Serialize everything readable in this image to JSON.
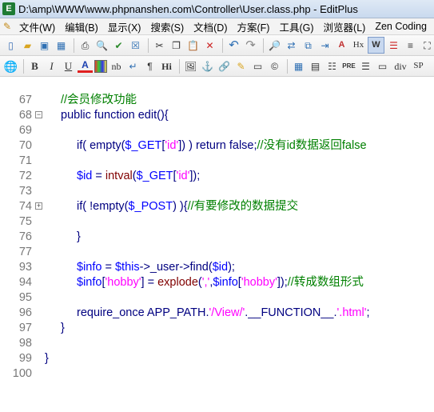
{
  "window": {
    "title": "D:\\amp\\WWW\\www.phpnanshen.com\\Controller\\User.class.php - EditPlus"
  },
  "menu": {
    "items": [
      "文件(W)",
      "编辑(B)",
      "显示(X)",
      "搜索(S)",
      "文档(D)",
      "方案(F)",
      "工具(G)",
      "浏览器(L)",
      "Zen Coding"
    ]
  },
  "toolbar2_text": {
    "nb": "nb",
    "para": "¶",
    "hi": "Hi",
    "pre": "PRE",
    "div": "div",
    "sp": "SP",
    "hx": "Hx"
  },
  "editor": {
    "lines": [
      {
        "num": "67",
        "fold": "",
        "code": ""
      },
      {
        "num": "68",
        "fold": "",
        "code": "comment1"
      },
      {
        "num": "69",
        "fold": "⊟",
        "code": "fn"
      },
      {
        "num": "70",
        "fold": "",
        "code": ""
      },
      {
        "num": "71",
        "fold": "",
        "code": "if1"
      },
      {
        "num": "72",
        "fold": "",
        "code": ""
      },
      {
        "num": "73",
        "fold": "",
        "code": "id"
      },
      {
        "num": "74",
        "fold": "",
        "code": ""
      },
      {
        "num": "75",
        "fold": "⊞",
        "code": "if2"
      },
      {
        "num": "76",
        "fold": "",
        "code": ""
      },
      {
        "num": "77",
        "fold": "",
        "code": "close1"
      },
      {
        "num": "93",
        "fold": "",
        "code": ""
      },
      {
        "num": "94",
        "fold": "",
        "code": "info"
      },
      {
        "num": "95",
        "fold": "",
        "code": "hobby"
      },
      {
        "num": "96",
        "fold": "",
        "code": ""
      },
      {
        "num": "97",
        "fold": "",
        "code": "require"
      },
      {
        "num": "98",
        "fold": "",
        "code": "close2"
      },
      {
        "num": "99",
        "fold": "",
        "code": ""
      },
      {
        "num": "100",
        "fold": "",
        "code": "close3"
      }
    ],
    "tokens": {
      "comment1": "//会员修改功能",
      "fn_kw": "public function edit",
      "fn_rest": "(){",
      "if1_a": "if( empty(",
      "if1_var": "$_GET",
      "if1_b": "[",
      "if1_str": "'id'",
      "if1_c": "]) ) return false;",
      "if1_cm": "//没有id数据返回false",
      "id_var": "$id",
      "id_eq": " = ",
      "id_fn": "intval",
      "id_p": "(",
      "id_get": "$_GET",
      "id_b": "[",
      "id_str": "'id'",
      "id_end": "]);",
      "if2_a": "if( !empty(",
      "if2_var": "$_POST",
      "if2_b": ") ){",
      "if2_cm": "//有要修改的数据提交",
      "close": "}",
      "info_var": "$info",
      "info_eq": " = ",
      "info_this": "$this",
      "info_arrow": "->_user->find(",
      "info_id": "$id",
      "info_end": ");",
      "hobby_var": "$info",
      "hobby_b": "[",
      "hobby_key": "'hobby'",
      "hobby_c": "] = ",
      "hobby_fn": "explode",
      "hobby_p": "(",
      "hobby_sep": "','",
      "hobby_comma": ",",
      "hobby_info": "$info",
      "hobby_b2": "[",
      "hobby_key2": "'hobby'",
      "hobby_end": "]);",
      "hobby_cm": "//转成数组形式",
      "req_kw": "require_once ",
      "req_const": "APP_PATH.",
      "req_str1": "'/View/'",
      "req_dot": ".__FUNCTION__.",
      "req_str2": "'.html'",
      "req_end": ";"
    }
  },
  "colors": {
    "comment": "#008000",
    "string": "#ff00ff",
    "variable": "#0000ff",
    "keyword": "#000080"
  }
}
